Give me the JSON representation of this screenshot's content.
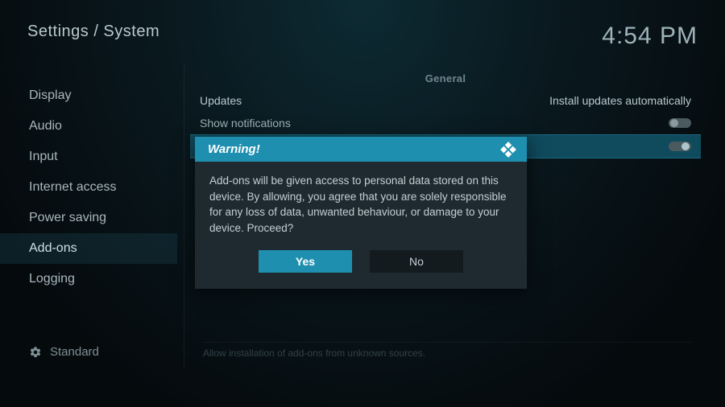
{
  "header": {
    "breadcrumb": "Settings / System",
    "clock": "4:54 PM"
  },
  "sidebar": {
    "items": [
      {
        "label": "Display"
      },
      {
        "label": "Audio"
      },
      {
        "label": "Input"
      },
      {
        "label": "Internet access"
      },
      {
        "label": "Power saving"
      },
      {
        "label": "Add-ons",
        "selected": true
      },
      {
        "label": "Logging"
      }
    ]
  },
  "level": {
    "label": "Standard"
  },
  "content": {
    "section_header": "General",
    "rows": {
      "updates": {
        "label": "Updates",
        "value": "Install updates automatically"
      },
      "notifications": {
        "label": "Show notifications",
        "toggle": "off"
      },
      "unknown_sources": {
        "label_hidden_behind_modal": "",
        "toggle": "on"
      }
    },
    "description": "Allow installation of add-ons from unknown sources."
  },
  "modal": {
    "title": "Warning!",
    "body": "Add-ons will be given access to personal data stored on this device. By allowing, you agree that you are solely responsible for any loss of data, unwanted behaviour, or damage to your device. Proceed?",
    "yes": "Yes",
    "no": "No"
  }
}
